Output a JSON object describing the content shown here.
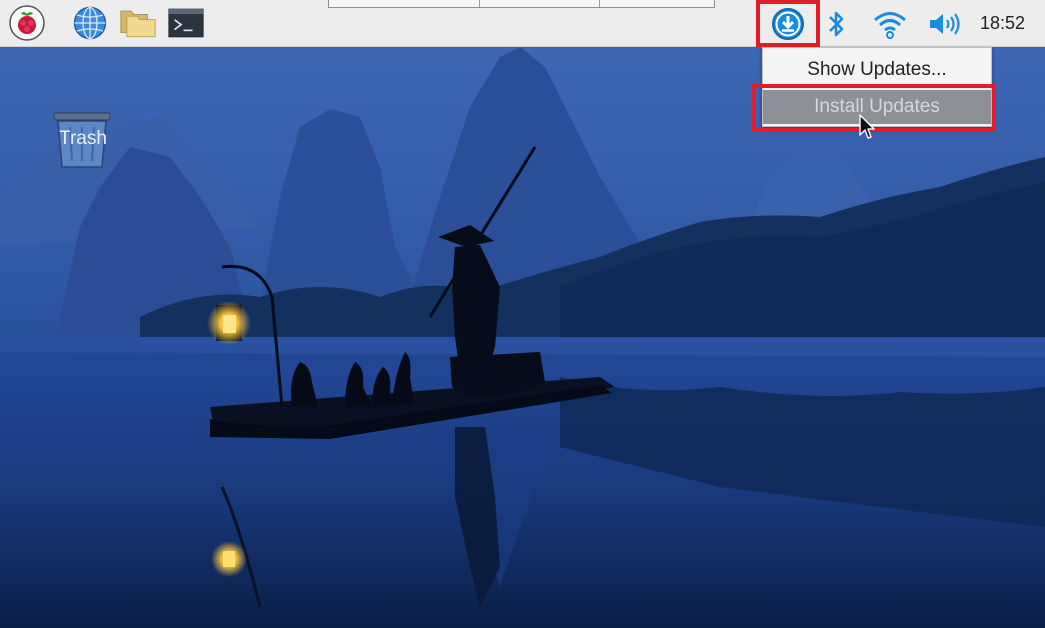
{
  "taskbar": {
    "launchers": [
      {
        "name": "raspberry-menu",
        "icon": "raspberry-pi-logo-icon"
      },
      {
        "name": "web-browser",
        "icon": "globe-icon"
      },
      {
        "name": "file-manager",
        "icon": "folders-icon"
      },
      {
        "name": "terminal",
        "icon": "terminal-icon"
      }
    ],
    "tray": {
      "updates_icon": "download-updates-icon",
      "bluetooth_icon": "bluetooth-icon",
      "wifi_icon": "wifi-icon",
      "volume_icon": "volume-icon"
    },
    "clock": "18:52"
  },
  "desktop": {
    "trash_label": "Trash"
  },
  "updates_menu": {
    "items": [
      {
        "label": "Show Updates..."
      },
      {
        "label": "Install Updates"
      }
    ],
    "hovered_item": "Install Updates"
  },
  "colors": {
    "highlight_red": "#e01d2a",
    "panel_bg": "#ededed",
    "menu_hover": "#8b9196",
    "accent_blue": "#1a8ce0"
  }
}
